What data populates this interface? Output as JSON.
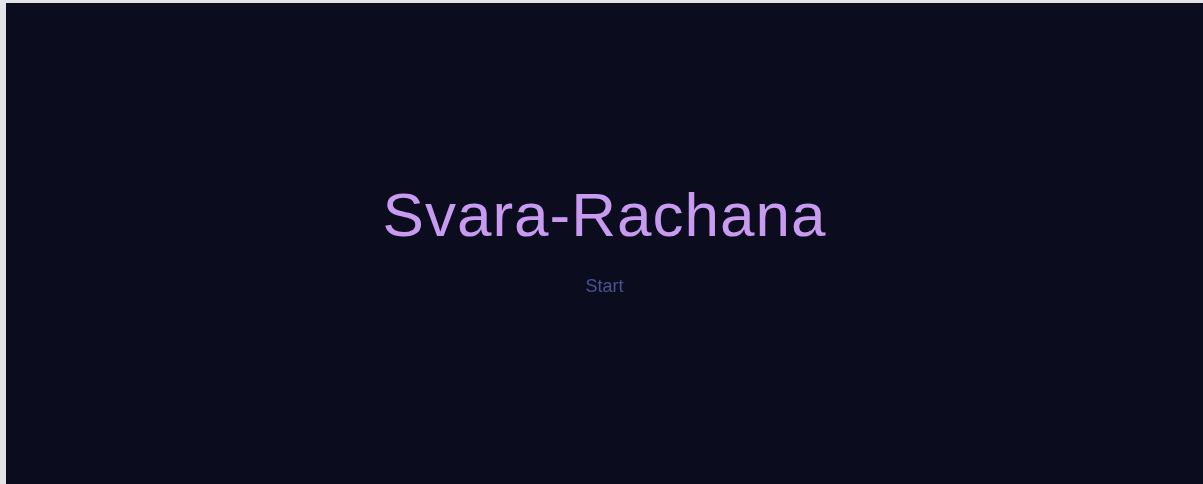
{
  "title": "Svara-Rachana",
  "start_button": {
    "label": "Start"
  }
}
